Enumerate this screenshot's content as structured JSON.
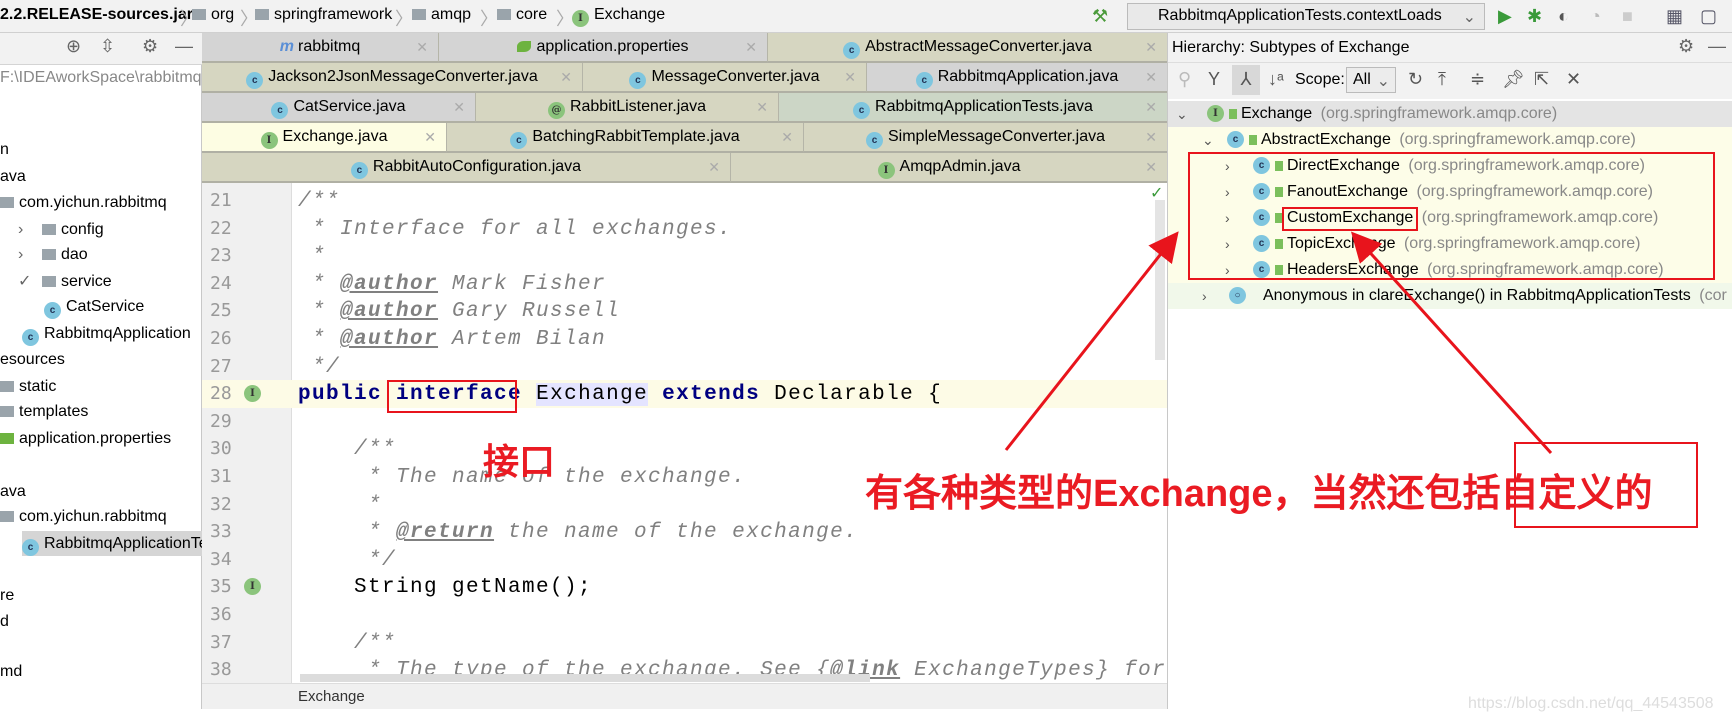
{
  "breadcrumb": [
    "2.2.RELEASE-sources.jar",
    "org",
    "springframework",
    "amqp",
    "core",
    "Exchange"
  ],
  "run_config": "RabbitmqApplicationTests.contextLoads",
  "project_path": "F:\\IDEAworkSpace\\rabbitmq",
  "project_tree": [
    {
      "label": "n",
      "indent": 0
    },
    {
      "label": "ava",
      "indent": 0
    },
    {
      "label": "com.yichun.rabbitmq",
      "indent": 1,
      "icon": "folder"
    },
    {
      "label": "config",
      "indent": 2,
      "icon": "folder",
      "arrow": "›"
    },
    {
      "label": "dao",
      "indent": 2,
      "icon": "folder",
      "arrow": "›"
    },
    {
      "label": "service",
      "indent": 2,
      "icon": "folder",
      "arrow": "✓"
    },
    {
      "label": "CatService",
      "indent": 3,
      "icon": "class"
    },
    {
      "label": "RabbitmqApplication",
      "indent": 2,
      "icon": "class"
    },
    {
      "label": "esources",
      "indent": 0
    },
    {
      "label": "static",
      "indent": 1,
      "icon": "folder"
    },
    {
      "label": "templates",
      "indent": 1,
      "icon": "folder"
    },
    {
      "label": "application.properties",
      "indent": 1,
      "icon": "spring"
    },
    {
      "label": "",
      "indent": 0
    },
    {
      "label": "ava",
      "indent": 0
    },
    {
      "label": "com.yichun.rabbitmq",
      "indent": 1,
      "icon": "folder"
    },
    {
      "label": "RabbitmqApplicationTests",
      "indent": 2,
      "icon": "class",
      "selected": true
    },
    {
      "label": "",
      "indent": 0
    },
    {
      "label": "re",
      "indent": 0
    },
    {
      "label": "d",
      "indent": 0
    },
    {
      "label": "",
      "indent": 0
    },
    {
      "label": "md",
      "indent": 0
    }
  ],
  "tabs": [
    [
      {
        "label": "rabbitmq",
        "icon": "m"
      },
      {
        "label": "application.properties",
        "icon": "spring"
      },
      {
        "label": "AbstractMessageConverter.java",
        "icon": "C"
      }
    ],
    [
      {
        "label": "Jackson2JsonMessageConverter.java",
        "icon": "C"
      },
      {
        "label": "MessageConverter.java",
        "icon": "C"
      },
      {
        "label": "RabbitmqApplication.java",
        "icon": "C"
      }
    ],
    [
      {
        "label": "CatService.java",
        "icon": "C"
      },
      {
        "label": "RabbitListener.java",
        "icon": "@"
      },
      {
        "label": "RabbitmqApplicationTests.java",
        "icon": "C"
      }
    ],
    [
      {
        "label": "Exchange.java",
        "icon": "I",
        "active": true
      },
      {
        "label": "BatchingRabbitTemplate.java",
        "icon": "C"
      },
      {
        "label": "SimpleMessageConverter.java",
        "icon": "C"
      }
    ],
    [
      {
        "label": "RabbitAutoConfiguration.java",
        "icon": "C"
      },
      {
        "label": "AmqpAdmin.java",
        "icon": "I"
      }
    ]
  ],
  "code": [
    {
      "n": "21",
      "t": "/**"
    },
    {
      "n": "22",
      "t": " * Interface for all exchanges."
    },
    {
      "n": "23",
      "t": " *"
    },
    {
      "n": "24",
      "t": " * @author Mark Fisher"
    },
    {
      "n": "25",
      "t": " * @author Gary Russell"
    },
    {
      "n": "26",
      "t": " * @author Artem Bilan"
    },
    {
      "n": "27",
      "t": " */"
    },
    {
      "n": "28",
      "t": "public interface Exchange extends Declarable {"
    },
    {
      "n": "29",
      "t": ""
    },
    {
      "n": "30",
      "t": "    /**"
    },
    {
      "n": "31",
      "t": "     * The name of the exchange."
    },
    {
      "n": "32",
      "t": "     *"
    },
    {
      "n": "33",
      "t": "     * @return the name of the exchange."
    },
    {
      "n": "34",
      "t": "     */"
    },
    {
      "n": "35",
      "t": "    String getName();"
    },
    {
      "n": "36",
      "t": ""
    },
    {
      "n": "37",
      "t": "    /**"
    },
    {
      "n": "38",
      "t": "     * The type of the exchange. See {@link ExchangeTypes} for some"
    }
  ],
  "editor_breadcrumb": "Exchange",
  "hierarchy": {
    "title": "Hierarchy:  Subtypes of Exchange",
    "scope_label": "Scope:",
    "scope_value": "All",
    "rows": [
      {
        "name": "Exchange",
        "pkg": "(org.springframework.amqp.core)"
      },
      {
        "name": "AbstractExchange",
        "pkg": "(org.springframework.amqp.core)"
      },
      {
        "name": "DirectExchange",
        "pkg": "(org.springframework.amqp.core)"
      },
      {
        "name": "FanoutExchange",
        "pkg": "(org.springframework.amqp.core)"
      },
      {
        "name": "CustomExchange",
        "pkg": "(org.springframework.amqp.core)"
      },
      {
        "name": "TopicExchange",
        "pkg": "(org.springframework.amqp.core)"
      },
      {
        "name": "HeadersExchange",
        "pkg": "(org.springframework.amqp.core)"
      },
      {
        "name": "Anonymous in clareExchange() in RabbitmqApplicationTests",
        "pkg": "(cor"
      }
    ]
  },
  "annotations": {
    "interface_note": "接口",
    "types_note": "有各种类型的Exchange，当然还包括自定义的",
    "color": "#e8141c"
  },
  "watermark": "https://blog.csdn.net/qq_44543508"
}
